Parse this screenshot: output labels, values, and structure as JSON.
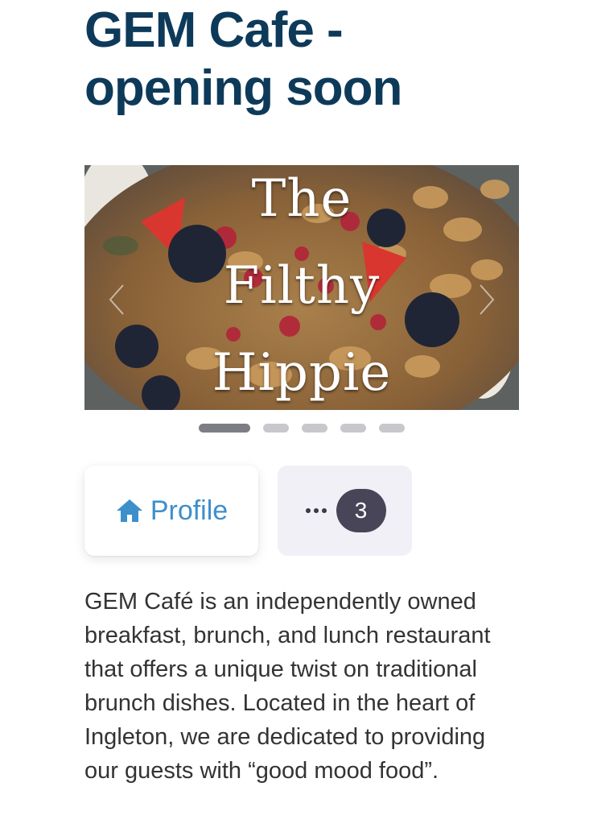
{
  "header": {
    "title": "GEM Cafe - opening soon"
  },
  "carousel": {
    "caption_lines": [
      "The",
      "Filthy",
      "Hippie"
    ],
    "slide_count": 5,
    "active_index": 0
  },
  "actions": {
    "profile_label": "Profile",
    "profile_icon": "home-icon",
    "more_icon": "more-horizontal-icon",
    "more_count": "3"
  },
  "description": {
    "text": "GEM Café is an independently owned breakfast, brunch, and lunch restaurant that offers a unique twist on traditional brunch dishes. Located in the heart of Ingleton, we are dedicated to providing our guests with “good mood food”."
  },
  "colors": {
    "title": "#0e3a5a",
    "link": "#3d8fcc",
    "badge": "#484558",
    "more_bg": "#f1f0f6",
    "dot_active": "#7d7d86",
    "dot_inactive": "#c8c8cc"
  }
}
